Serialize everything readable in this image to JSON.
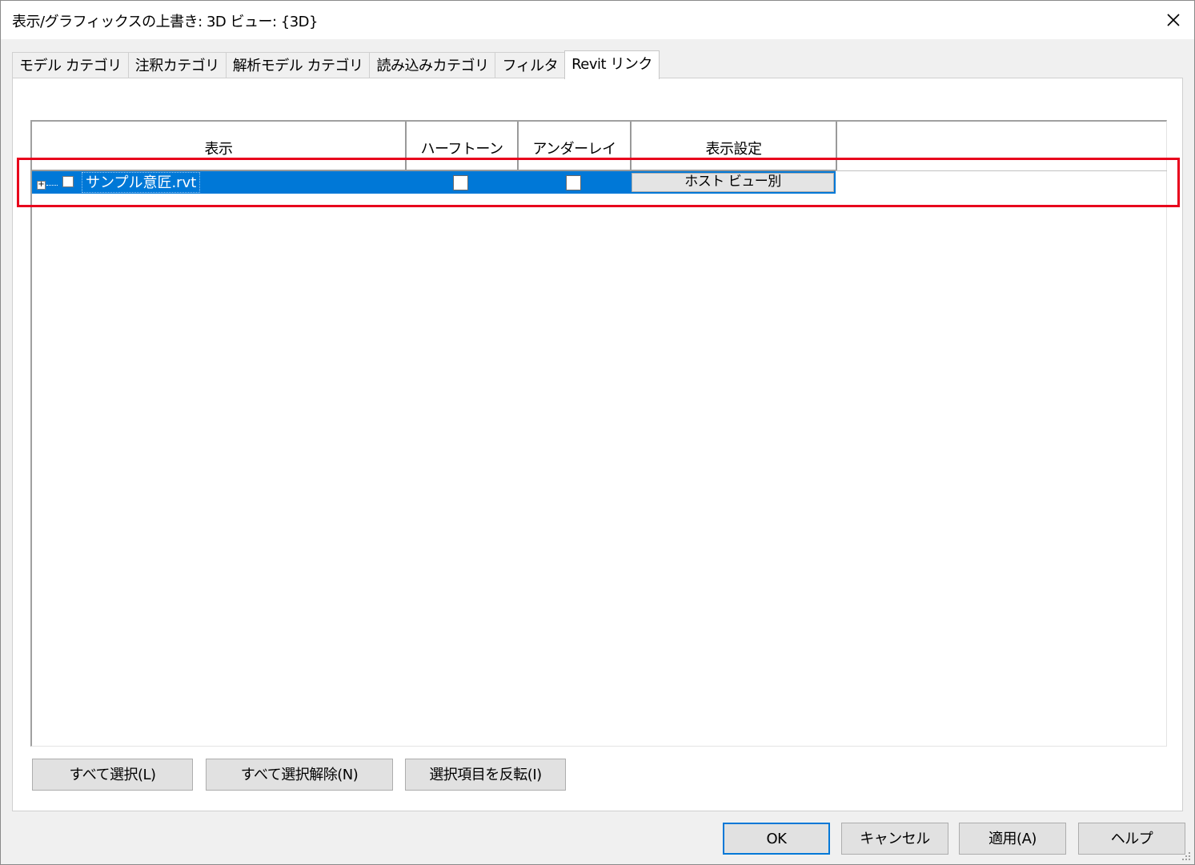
{
  "window": {
    "title": "表示/グラフィックスの上書き: 3D ビュー: {3D}",
    "close_glyph": "✕"
  },
  "tabs": [
    {
      "label": "モデル カテゴリ",
      "active": false
    },
    {
      "label": "注釈カテゴリ",
      "active": false
    },
    {
      "label": "解析モデル カテゴリ",
      "active": false
    },
    {
      "label": "読み込みカテゴリ",
      "active": false
    },
    {
      "label": "フィルタ",
      "active": false
    },
    {
      "label": "Revit リンク",
      "active": true
    }
  ],
  "grid": {
    "columns": [
      "表示",
      "ハーフトーン",
      "アンダーレイ",
      "表示設定"
    ],
    "rows": [
      {
        "expander": "+",
        "visible_checked": false,
        "name": "サンプル意匠.rvt",
        "halftone_checked": false,
        "underlay_checked": false,
        "display_setting": "ホスト ビュー別",
        "selected": true
      }
    ]
  },
  "selection_buttons": {
    "select_all": "すべて選択(L)",
    "deselect_all": "すべて選択解除(N)",
    "invert": "選択項目を反転(I)"
  },
  "dialog_buttons": {
    "ok": "OK",
    "cancel": "キャンセル",
    "apply": "適用(A)",
    "help": "ヘルプ"
  },
  "colors": {
    "selection": "#0078d7",
    "highlight_box": "#e8001c"
  }
}
